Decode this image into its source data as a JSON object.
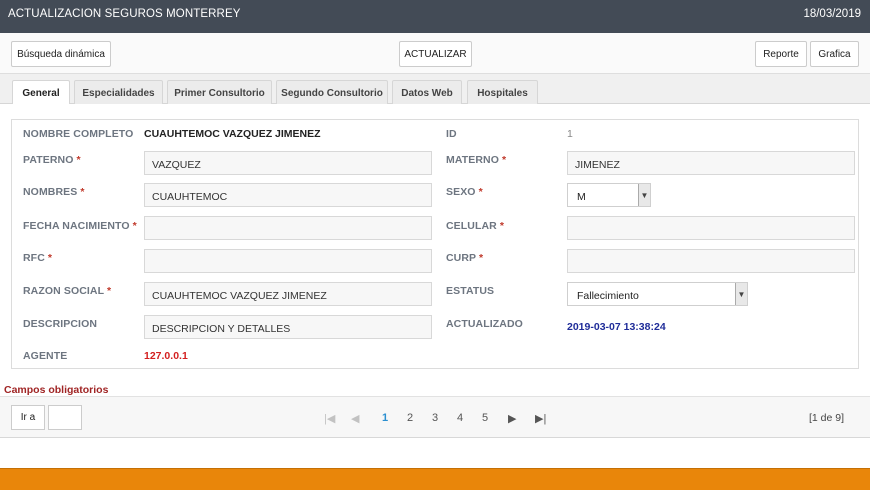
{
  "header": {
    "title": "ACTUALIZACION SEGUROS MONTERREY",
    "date": "18/03/2019"
  },
  "toolbar": {
    "search_label": "Búsqueda dinámica",
    "update_label": "ACTUALIZAR",
    "report_label": "Reporte",
    "chart_label": "Grafica"
  },
  "tabs": [
    {
      "label": "General",
      "active": true
    },
    {
      "label": "Especialidades"
    },
    {
      "label": "Primer Consultorio"
    },
    {
      "label": "Segundo Consultorio"
    },
    {
      "label": "Datos Web"
    },
    {
      "label": "Hospitales"
    }
  ],
  "form": {
    "nombre_completo": {
      "label": "NOMBRE COMPLETO",
      "value": "CUAUHTEMOC VAZQUEZ JIMENEZ"
    },
    "id": {
      "label": "ID",
      "value": "1"
    },
    "paterno": {
      "label": "PATERNO",
      "value": "VAZQUEZ"
    },
    "materno": {
      "label": "MATERNO",
      "value": "JIMENEZ"
    },
    "nombres": {
      "label": "NOMBRES",
      "value": "CUAUHTEMOC"
    },
    "sexo": {
      "label": "SEXO",
      "value": "M"
    },
    "fecha_nacimiento": {
      "label": "FECHA NACIMIENTO",
      "value": ""
    },
    "celular": {
      "label": "CELULAR",
      "value": ""
    },
    "rfc": {
      "label": "RFC",
      "value": ""
    },
    "curp": {
      "label": "CURP",
      "value": ""
    },
    "razon_social": {
      "label": "RAZON SOCIAL",
      "value": "CUAUHTEMOC VAZQUEZ JIMENEZ"
    },
    "estatus": {
      "label": "ESTATUS",
      "value": "Fallecimiento"
    },
    "descripcion": {
      "label": "DESCRIPCION",
      "value": "DESCRIPCION Y DETALLES"
    },
    "actualizado": {
      "label": "ACTUALIZADO",
      "value": "2019-03-07 13:38:24"
    },
    "agente": {
      "label": "AGENTE",
      "value": "127.0.0.1"
    },
    "required_marker": "*"
  },
  "required_note": "Campos obligatorios",
  "pager": {
    "goto_label": "Ir a",
    "pages": [
      "1",
      "2",
      "3",
      "4",
      "5"
    ],
    "current": "1",
    "count": "[1 de 9]"
  },
  "colors": {
    "header_bg": "#434b56",
    "footer_bg": "#e9860a",
    "required": "#c0392b",
    "timestamp": "#1f2c99",
    "agent": "#d31f1f",
    "current_page": "#2a8fd0"
  }
}
